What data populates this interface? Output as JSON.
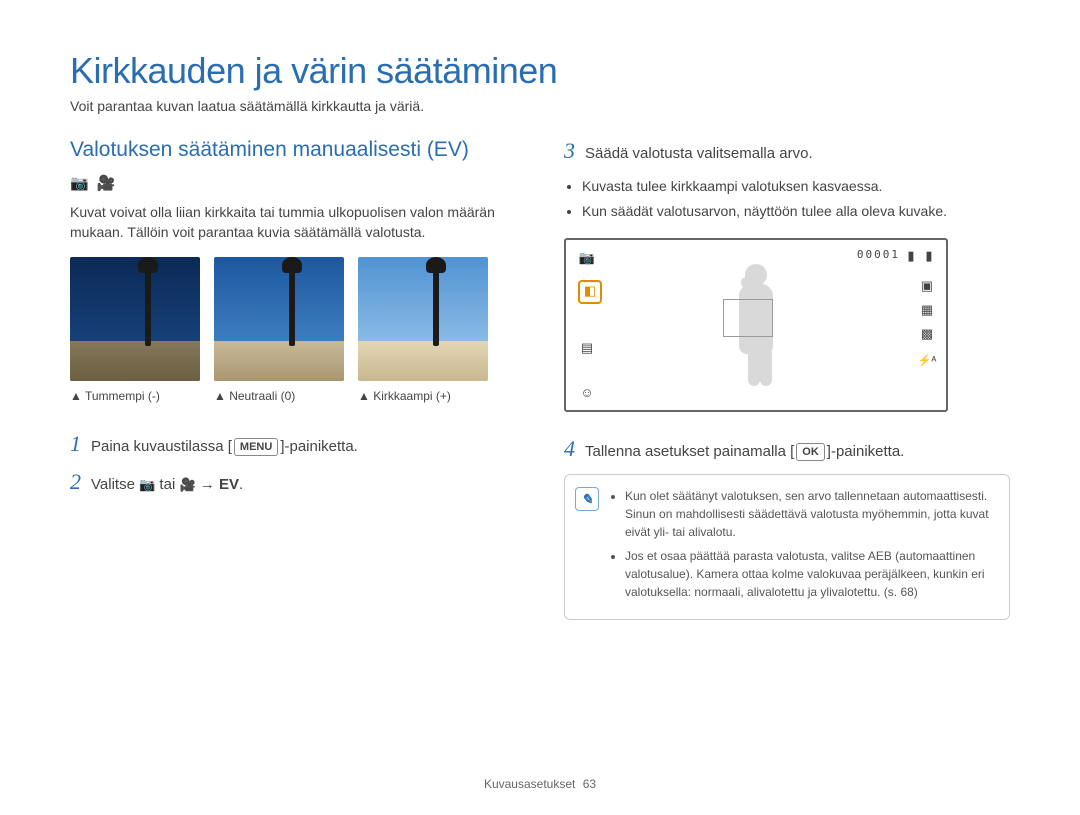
{
  "page": {
    "title": "Kirkkauden ja värin säätäminen",
    "subtitle": "Voit parantaa kuvan laatua säätämällä kirkkautta ja väriä."
  },
  "left": {
    "section_title": "Valotuksen säätäminen manuaalisesti (EV)",
    "intro": "Kuvat voivat olla liian kirkkaita tai tummia ulkopuolisen valon määrän mukaan. Tällöin voit parantaa kuvia säätämällä valotusta.",
    "captions": {
      "darker": "▲ Tummempi (-)",
      "neutral": "▲ Neutraali (0)",
      "brighter": "▲ Kirkkaampi (+)"
    },
    "step1": {
      "num": "1",
      "before": "Paina kuvaustilassa [",
      "btn": "MENU",
      "after": "]-painiketta."
    },
    "step2": {
      "num": "2",
      "before": "Valitse ",
      "mid": " tai ",
      "arrow": " → ",
      "ev": "EV",
      "end": "."
    }
  },
  "right": {
    "step3": {
      "num": "3",
      "text": "Säädä valotusta valitsemalla arvo."
    },
    "step3_bullets": [
      "Kuvasta tulee kirkkaampi valotuksen kasvaessa.",
      "Kun säädät valotusarvon, näyttöön tulee alla oleva kuvake."
    ],
    "lcd": {
      "counter": "00001"
    },
    "step4": {
      "num": "4",
      "before": "Tallenna asetukset painamalla [",
      "btn": "OK",
      "after": "]-painiketta."
    },
    "notes": [
      "Kun olet säätänyt valotuksen, sen arvo tallennetaan automaattisesti. Sinun on mahdollisesti säädettävä valotusta myöhemmin, jotta kuvat eivät yli- tai alivalotu.",
      "Jos et osaa päättää parasta valotusta, valitse AEB (automaattinen valotusalue). Kamera ottaa kolme valokuvaa peräjälkeen, kunkin eri valotuksella: normaali, alivalotettu ja ylivalotettu. (s. 68)"
    ]
  },
  "footer": {
    "section": "Kuvausasetukset",
    "page_num": "63"
  }
}
